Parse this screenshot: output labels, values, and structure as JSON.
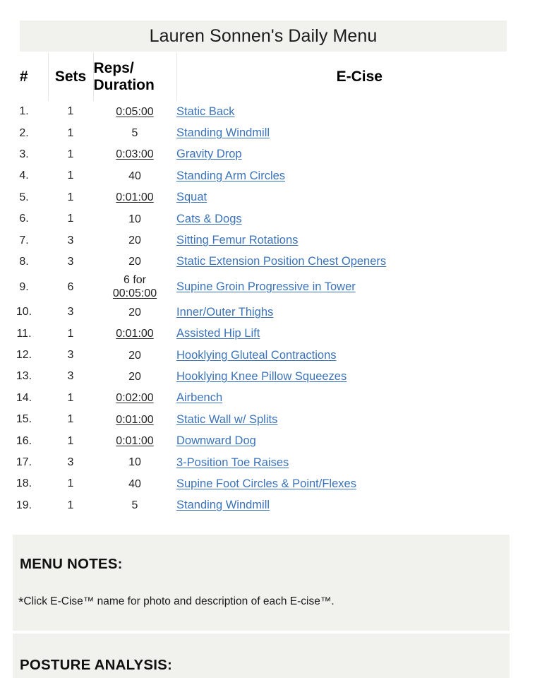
{
  "header": {
    "title": "Lauren Sonnen's Daily Menu"
  },
  "table": {
    "columns": {
      "number": "#",
      "sets": "Sets",
      "reps_line1": "Reps/",
      "reps_line2": "Duration",
      "ecise": "E-Cise"
    },
    "rows": [
      {
        "num": "1.",
        "sets": "1",
        "reps": "0:05:00",
        "reps_is_duration": true,
        "ecise": "Static Back"
      },
      {
        "num": "2.",
        "sets": "1",
        "reps": "5",
        "reps_is_duration": false,
        "ecise": "Standing Windmill"
      },
      {
        "num": "3.",
        "sets": "1",
        "reps": "0:03:00",
        "reps_is_duration": true,
        "ecise": "Gravity Drop"
      },
      {
        "num": "4.",
        "sets": "1",
        "reps": "40",
        "reps_is_duration": false,
        "ecise": "Standing Arm Circles"
      },
      {
        "num": "5.",
        "sets": "1",
        "reps": "0:01:00",
        "reps_is_duration": true,
        "ecise": "Squat"
      },
      {
        "num": "6.",
        "sets": "1",
        "reps": "10",
        "reps_is_duration": false,
        "ecise": "Cats & Dogs"
      },
      {
        "num": "7.",
        "sets": "3",
        "reps": "20",
        "reps_is_duration": false,
        "ecise": "Sitting Femur Rotations"
      },
      {
        "num": "8.",
        "sets": "3",
        "reps": "20",
        "reps_is_duration": false,
        "ecise": "Static Extension Position Chest Openers"
      },
      {
        "num": "9.",
        "sets": "6",
        "reps_prefix": "6 for",
        "reps": "00:05:00",
        "reps_is_duration": true,
        "ecise": "Supine Groin Progressive in Tower"
      },
      {
        "num": "10.",
        "sets": "3",
        "reps": "20",
        "reps_is_duration": false,
        "ecise": "Inner/Outer Thighs"
      },
      {
        "num": "11.",
        "sets": "1",
        "reps": "0:01:00",
        "reps_is_duration": true,
        "ecise": "Assisted Hip Lift"
      },
      {
        "num": "12.",
        "sets": "3",
        "reps": "20",
        "reps_is_duration": false,
        "ecise": "Hooklying Gluteal Contractions"
      },
      {
        "num": "13.",
        "sets": "3",
        "reps": "20",
        "reps_is_duration": false,
        "ecise": "Hooklying Knee Pillow Squeezes"
      },
      {
        "num": "14.",
        "sets": "1",
        "reps": "0:02:00",
        "reps_is_duration": true,
        "ecise": "Airbench"
      },
      {
        "num": "15.",
        "sets": "1",
        "reps": "0:01:00",
        "reps_is_duration": true,
        "ecise": "Static Wall w/ Splits"
      },
      {
        "num": "16.",
        "sets": "1",
        "reps": "0:01:00",
        "reps_is_duration": true,
        "ecise": "Downward Dog"
      },
      {
        "num": "17.",
        "sets": "3",
        "reps": "10",
        "reps_is_duration": false,
        "ecise": "3-Position Toe Raises"
      },
      {
        "num": "18.",
        "sets": "1",
        "reps": "40",
        "reps_is_duration": false,
        "ecise": "Supine Foot Circles & Point/Flexes"
      },
      {
        "num": "19.",
        "sets": "1",
        "reps": "5",
        "reps_is_duration": false,
        "ecise": "Standing Windmill"
      }
    ]
  },
  "notes": {
    "heading": "MENU NOTES:",
    "star": "*",
    "body": "Click E-Cise™ name for photo and description of each E-cise™."
  },
  "posture": {
    "heading": "POSTURE ANALYSIS:"
  },
  "colors": {
    "panel_background": "#f1f1ed",
    "link": "#3b73b9",
    "page_background": "#ffffff",
    "text": "#1a1a1a"
  }
}
